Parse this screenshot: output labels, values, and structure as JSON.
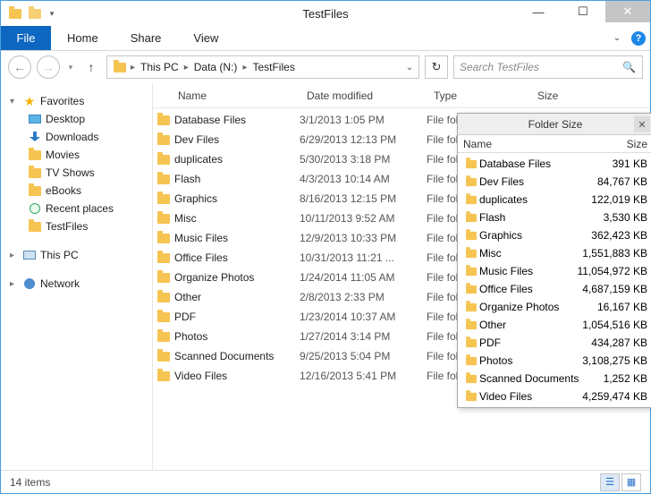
{
  "window": {
    "title": "TestFiles"
  },
  "ribbon": {
    "file": "File",
    "tabs": [
      "Home",
      "Share",
      "View"
    ]
  },
  "breadcrumb": {
    "segments": [
      "This PC",
      "Data (N:)",
      "TestFiles"
    ]
  },
  "search": {
    "placeholder": "Search TestFiles"
  },
  "nav": {
    "favorites": {
      "label": "Favorites",
      "items": [
        "Desktop",
        "Downloads",
        "Movies",
        "TV Shows",
        "eBooks",
        "Recent places",
        "TestFiles"
      ]
    },
    "this_pc": "This PC",
    "network": "Network"
  },
  "columns": {
    "name": "Name",
    "date": "Date modified",
    "type": "Type",
    "size": "Size"
  },
  "type_truncated": "File fol",
  "files": [
    {
      "name": "Database Files",
      "date": "3/1/2013 1:05 PM"
    },
    {
      "name": "Dev Files",
      "date": "6/29/2013 12:13 PM"
    },
    {
      "name": "duplicates",
      "date": "5/30/2013 3:18 PM"
    },
    {
      "name": "Flash",
      "date": "4/3/2013 10:14 AM"
    },
    {
      "name": "Graphics",
      "date": "8/16/2013 12:15 PM"
    },
    {
      "name": "Misc",
      "date": "10/11/2013 9:52 AM"
    },
    {
      "name": "Music Files",
      "date": "12/9/2013 10:33 PM"
    },
    {
      "name": "Office Files",
      "date": "10/31/2013 11:21 ..."
    },
    {
      "name": "Organize Photos",
      "date": "1/24/2014 11:05 AM"
    },
    {
      "name": "Other",
      "date": "2/8/2013 2:33 PM"
    },
    {
      "name": "PDF",
      "date": "1/23/2014 10:37 AM"
    },
    {
      "name": "Photos",
      "date": "1/27/2014 3:14 PM"
    },
    {
      "name": "Scanned Documents",
      "date": "9/25/2013 5:04 PM"
    },
    {
      "name": "Video Files",
      "date": "12/16/2013 5:41 PM"
    }
  ],
  "status": {
    "items": "14 items"
  },
  "folder_size": {
    "title": "Folder Size",
    "header_name": "Name",
    "header_size": "Size",
    "rows": [
      {
        "name": "Database Files",
        "size": "391 KB"
      },
      {
        "name": "Dev Files",
        "size": "84,767 KB"
      },
      {
        "name": "duplicates",
        "size": "122,019 KB"
      },
      {
        "name": "Flash",
        "size": "3,530 KB"
      },
      {
        "name": "Graphics",
        "size": "362,423 KB"
      },
      {
        "name": "Misc",
        "size": "1,551,883 KB"
      },
      {
        "name": "Music Files",
        "size": "11,054,972 KB"
      },
      {
        "name": "Office Files",
        "size": "4,687,159 KB"
      },
      {
        "name": "Organize Photos",
        "size": "16,167 KB"
      },
      {
        "name": "Other",
        "size": "1,054,516 KB"
      },
      {
        "name": "PDF",
        "size": "434,287 KB"
      },
      {
        "name": "Photos",
        "size": "3,108,275 KB"
      },
      {
        "name": "Scanned Documents",
        "size": "1,252 KB"
      },
      {
        "name": "Video Files",
        "size": "4,259,474 KB"
      }
    ]
  }
}
